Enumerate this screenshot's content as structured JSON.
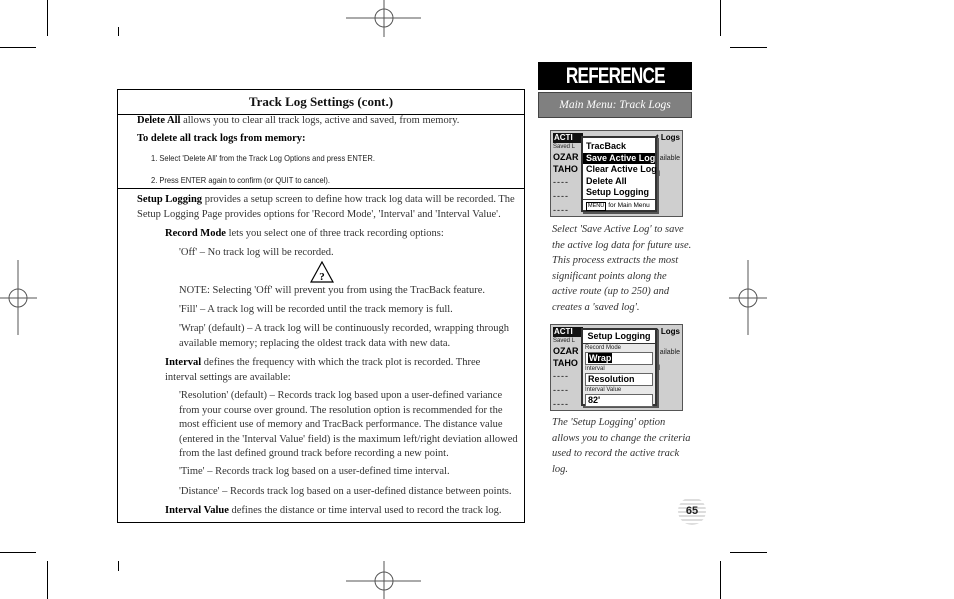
{
  "main": {
    "title": "Track Log Settings (cont.)",
    "delete_all": {
      "term": "Delete All",
      "text": " allows you to clear all track logs, active and saved, from memory."
    },
    "delete_heading": "To delete all track logs from memory:",
    "steps": [
      "1. Select 'Delete All' from the Track Log Options and press ENTER.",
      "2. Press ENTER again to confirm (or QUIT to cancel)."
    ],
    "setup_logging": {
      "term": "Setup Logging",
      "text": " provides a setup screen to define how track log data will be recorded. The Setup Logging Page provides options for 'Record Mode', 'Interval' and 'Interval Value'."
    },
    "record_mode": {
      "term": "Record Mode",
      "text": " lets you select one of three track recording options:"
    },
    "off_option": "'Off' – No track log will be recorded.",
    "note_icon": "warning-question-icon",
    "note": "NOTE: Selecting 'Off' will prevent you from using the TracBack feature.",
    "fill_option": "'Fill' – A track log will be recorded until the track memory is full.",
    "wrap_option": "'Wrap' (default) – A track log will be continuously recorded, wrapping through available memory; replacing the oldest track data with new data.",
    "interval": {
      "term": "Interval",
      "text": " defines the frequency with which the track plot is recorded. Three interval settings are available:"
    },
    "resolution_option": "'Resolution' (default) – Records track log based upon a user-defined variance from your course over ground. The resolution option is recommended for the most efficient use of memory and TracBack performance. The distance value (entered in the 'Interval Value' field) is the maximum left/right deviation allowed from the last defined ground track before recording a new point.",
    "time_option": "'Time' – Records track log based on a user-defined time interval.",
    "distance_option": "'Distance' – Records track log based on a user-defined distance between points.",
    "interval_value": {
      "term": "Interval Value",
      "text": " defines the distance or time interval used to record the track log."
    }
  },
  "sidebar": {
    "section": "REFERENCE",
    "subsection": "Main Menu: Track Logs",
    "screen1": {
      "bg_header": "ACTI",
      "bg_sub": "Saved L",
      "bg_rows": [
        "OZAR",
        "TAHO",
        "----",
        "----",
        "----"
      ],
      "bg_right_title": "t Logs",
      "bg_right_lines": [
        "ailable",
        "ed"
      ],
      "menu_items": [
        "TracBack",
        "Save Active Log",
        "Clear Active Log",
        "Delete All",
        "Setup Logging"
      ],
      "selected_index": 1,
      "footer_key": "MENU",
      "footer_text": "for Main Menu"
    },
    "caption1": "Select 'Save Active Log' to save the active log data for future use. This process extracts the most significant points along the active route (up to 250) and creates a 'saved log'.",
    "screen2": {
      "bg_header": "ACTI",
      "bg_sub": "Saved L",
      "bg_rows": [
        "OZAR",
        "TAHO",
        "----",
        "----",
        "----"
      ],
      "bg_right_title": "t Logs",
      "bg_right_lines": [
        "ailable",
        "ed"
      ],
      "title": "Setup Logging",
      "record_mode_label": "Record Mode",
      "record_mode_value": "Wrap",
      "interval_label": "Interval",
      "interval_value": "Resolution",
      "interval_value_label": "Interval Value",
      "interval_value_value": "82'"
    },
    "caption2": "The 'Setup Logging' option allows you to change the criteria used to record the active track log."
  },
  "page_number": "65"
}
